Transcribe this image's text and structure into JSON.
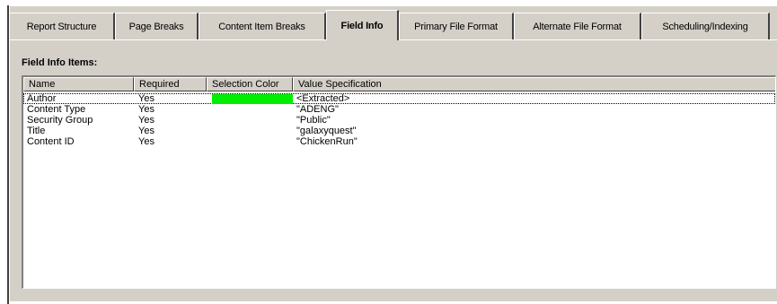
{
  "tabs": [
    {
      "label": "Report Structure",
      "active": false
    },
    {
      "label": "Page Breaks",
      "active": false
    },
    {
      "label": "Content Item Breaks",
      "active": false
    },
    {
      "label": "Field Info",
      "active": true
    },
    {
      "label": "Primary File Format",
      "active": false
    },
    {
      "label": "Alternate File Format",
      "active": false
    },
    {
      "label": "Scheduling/Indexing",
      "active": false
    }
  ],
  "panel": {
    "title": "Field Info Items:"
  },
  "table": {
    "columns": [
      "Name",
      "Required",
      "Selection Color",
      "Value Specification"
    ],
    "rows": [
      {
        "name": "Author",
        "required": "Yes",
        "selection_color": "#00ee00",
        "value": "<Extracted>"
      },
      {
        "name": "Content Type",
        "required": "Yes",
        "selection_color": "",
        "value": "\"ADENG\""
      },
      {
        "name": "Security Group",
        "required": "Yes",
        "selection_color": "",
        "value": "\"Public\""
      },
      {
        "name": "Title",
        "required": "Yes",
        "selection_color": "",
        "value": "\"galaxyquest\""
      },
      {
        "name": "Content ID",
        "required": "Yes",
        "selection_color": "",
        "value": "\"ChickenRun\""
      }
    ]
  },
  "colors": {
    "face": "#d4d0c8",
    "highlight": "#ffffff",
    "shadow": "#808080",
    "dark_shadow": "#404040",
    "list_background": "#ffffff"
  }
}
